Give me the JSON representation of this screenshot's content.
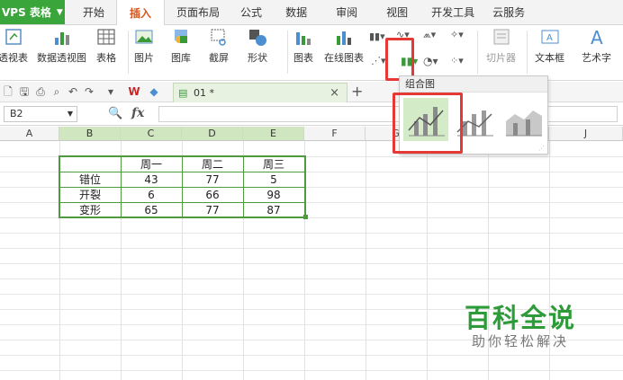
{
  "menubar": {
    "brand": "VPS 表格",
    "tabs": [
      {
        "label": "开始"
      },
      {
        "label": "插入"
      },
      {
        "label": "页面布局"
      },
      {
        "label": "公式"
      },
      {
        "label": "数据"
      },
      {
        "label": "审阅"
      },
      {
        "label": "视图"
      },
      {
        "label": "开发工具"
      },
      {
        "label": "云服务"
      }
    ],
    "active_tab": "插入"
  },
  "ribbon": {
    "pivot_table": "透视表",
    "pivot_chart": "数据透视图",
    "table": "表格",
    "picture": "图片",
    "gallery": "图库",
    "screenshot": "截屏",
    "shapes": "形状",
    "chart": "图表",
    "online_chart": "在线图表",
    "slicer": "切片器",
    "textbox": "文本框",
    "wordart": "艺术字"
  },
  "toolbar2": {
    "doc_tab": "01 *"
  },
  "formula_bar": {
    "name_box": "B2",
    "fx_label": "fx",
    "formula": ""
  },
  "columns": [
    "A",
    "B",
    "C",
    "D",
    "E",
    "F",
    "G",
    "H",
    "I",
    "J"
  ],
  "table": {
    "headers": [
      "",
      "周一",
      "周二",
      "周三"
    ],
    "rows": [
      {
        "label": "错位",
        "values": [
          "43",
          "77",
          "5"
        ]
      },
      {
        "label": "开裂",
        "values": [
          "6",
          "66",
          "98"
        ]
      },
      {
        "label": "变形",
        "values": [
          "65",
          "77",
          "87"
        ]
      }
    ]
  },
  "popup": {
    "title": "组合图"
  },
  "watermark": {
    "title": "百科全说",
    "subtitle": "助你轻松解决"
  },
  "colors": {
    "brand_green": "#3aa53a",
    "active_tab": "#d9541e",
    "table_border": "#4d9b3e",
    "highlight_red": "#e53935"
  }
}
